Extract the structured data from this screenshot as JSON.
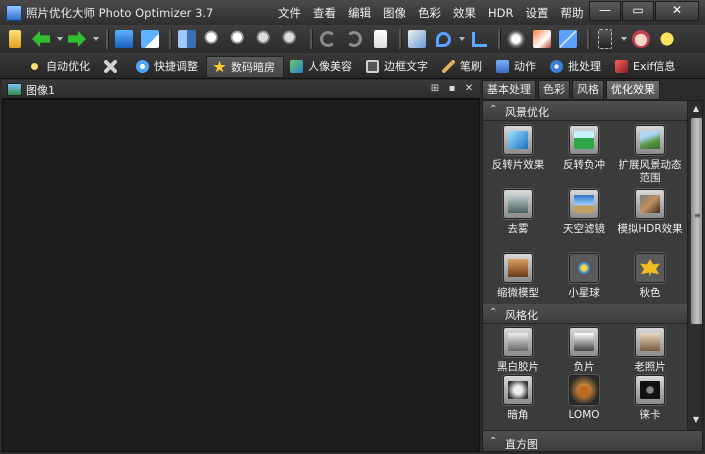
{
  "app": {
    "title": "照片优化大师 Photo Optimizer 3.7"
  },
  "menu": [
    "文件",
    "查看",
    "编辑",
    "图像",
    "色彩",
    "效果",
    "HDR",
    "设置",
    "帮助"
  ],
  "window_buttons": {
    "minimize": "—",
    "maximize": "▭",
    "close": "✕"
  },
  "function_tabs": [
    {
      "label": "自动优化",
      "icon": "magic-wand-icon",
      "color": "#f0c040"
    },
    {
      "label": "",
      "icon": "tools-icon",
      "color": "#c8c8c8"
    },
    {
      "label": "快捷调整",
      "icon": "quick-adjust-icon",
      "color": "#4aa8ff"
    },
    {
      "label": "数码暗房",
      "icon": "star-icon",
      "color": "#ffcc33"
    },
    {
      "label": "人像美容",
      "icon": "portrait-icon",
      "color": "#66cc66"
    },
    {
      "label": "边框文字",
      "icon": "frame-icon",
      "color": "#d0d0d0"
    },
    {
      "label": "笔刷",
      "icon": "brush-icon",
      "color": "#e0b060"
    },
    {
      "label": "动作",
      "icon": "film-icon",
      "color": "#7ab0ff"
    },
    {
      "label": "批处理",
      "icon": "batch-icon",
      "color": "#3a7fd6"
    },
    {
      "label": "Exif信息",
      "icon": "exif-icon",
      "color": "#d04040"
    }
  ],
  "document": {
    "title": "图像1"
  },
  "panel_tabs": [
    "基本处理",
    "色彩",
    "风格",
    "优化效果"
  ],
  "sections": [
    {
      "title": "风景优化",
      "items": [
        {
          "label": "反转片效果",
          "icon": "reversal-film-icon",
          "color": "#3d9be0"
        },
        {
          "label": "反转负冲",
          "icon": "cross-process-icon",
          "color": "#4bbf5a"
        },
        {
          "label": "扩展风景动态范围",
          "icon": "landscape-dynamic-range-icon",
          "color": "#7aa86a"
        },
        {
          "label": "去雾",
          "icon": "dehaze-icon",
          "color": "#7a8a8a"
        },
        {
          "label": "天空滤镜",
          "icon": "sky-filter-icon",
          "color": "#4a8fd8"
        },
        {
          "label": "模拟HDR效果",
          "icon": "hdr-icon",
          "color": "#8a6a4a"
        },
        {
          "label": "缩微模型",
          "icon": "miniature-icon",
          "color": "#a0703a"
        },
        {
          "label": "小星球",
          "icon": "tiny-planet-icon",
          "color": "#e0b040"
        },
        {
          "label": "秋色",
          "icon": "autumn-leaf-icon",
          "color": "#f0c020"
        }
      ]
    },
    {
      "title": "风格化",
      "items": [
        {
          "label": "黑白胶片",
          "icon": "bw-film-icon",
          "color": "#8a8a8a"
        },
        {
          "label": "负片",
          "icon": "negative-icon",
          "color": "#9a9a9a"
        },
        {
          "label": "老照片",
          "icon": "old-photo-icon",
          "color": "#b09070"
        },
        {
          "label": "暗角",
          "icon": "vignette-icon",
          "color": "#666666"
        },
        {
          "label": "LOMO",
          "icon": "lomo-bear-icon",
          "color": "#c07020"
        },
        {
          "label": "徕卡",
          "icon": "leica-camera-icon",
          "color": "#222222"
        }
      ]
    }
  ],
  "footer_section": {
    "title": "直方图"
  }
}
